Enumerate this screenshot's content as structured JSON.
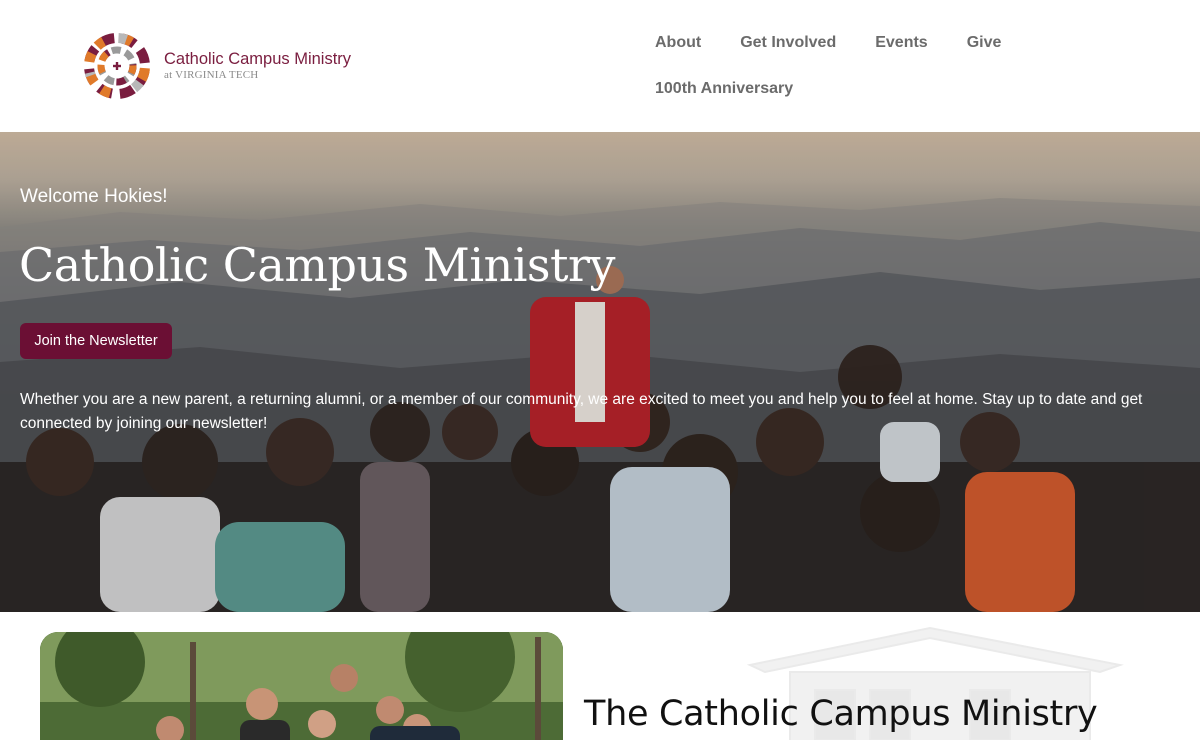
{
  "header": {
    "logo_title": "Catholic Campus Ministry",
    "logo_subtitle": "at VIRGINIA TECH",
    "nav": [
      {
        "label": "About"
      },
      {
        "label": "Get Involved"
      },
      {
        "label": "Events"
      },
      {
        "label": "Give"
      },
      {
        "label": "100th Anniversary"
      }
    ]
  },
  "hero": {
    "kicker": "Welcome Hokies!",
    "title": "Catholic Campus Ministry",
    "button_label": "Join the Newsletter",
    "description": "Whether you are a new parent, a returning alumni, or a member of our community, we are excited to meet you and help you to feel at home. Stay up to date and get connected by joining our newsletter!"
  },
  "intro": {
    "title": "The Catholic Campus Ministry"
  },
  "colors": {
    "brand": "#7a1d3f",
    "button": "#6b0f34",
    "nav_text": "#6b6b6b",
    "logo_orange": "#e07a2a",
    "logo_gray": "#9a9a9a"
  },
  "icons": {
    "logo": "ccm-rosette-logo",
    "watermark": "church-building-watermark"
  }
}
